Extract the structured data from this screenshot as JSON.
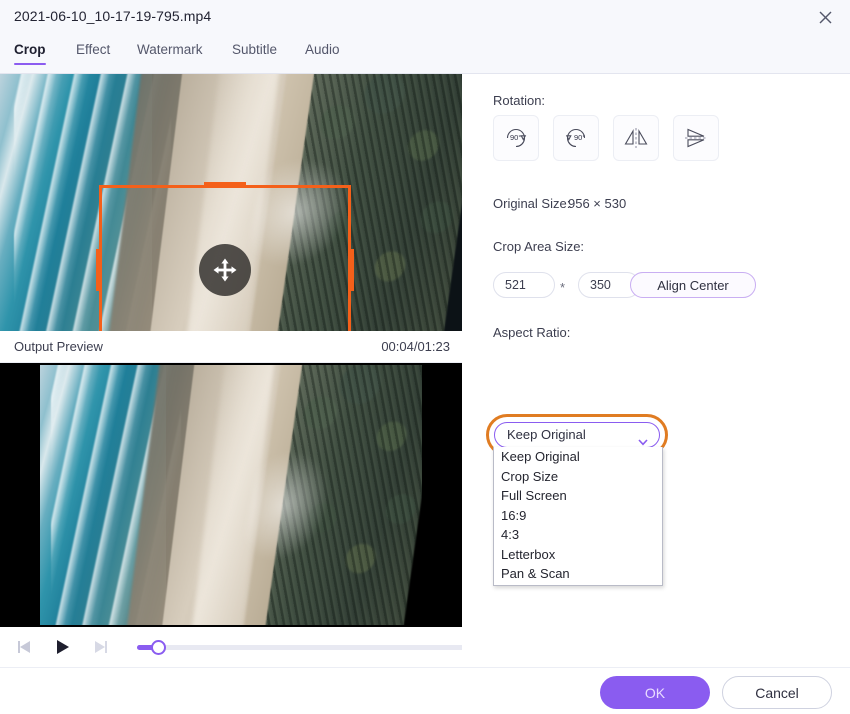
{
  "window": {
    "title": "2021-06-10_10-17-19-795.mp4",
    "close_icon": "close-icon"
  },
  "tabs": [
    {
      "label": "Crop",
      "active": true
    },
    {
      "label": "Effect",
      "active": false
    },
    {
      "label": "Watermark",
      "active": false
    },
    {
      "label": "Subtitle",
      "active": false
    },
    {
      "label": "Audio",
      "active": false
    }
  ],
  "source_preview": {
    "crop_overlay": {
      "move_handle_icon": "move-arrows-icon",
      "border_color": "#f4601a"
    }
  },
  "output_preview": {
    "label": "Output Preview",
    "time": "00:04/01:23"
  },
  "transport": {
    "prev_frame_icon": "previous-frame-icon",
    "play_icon": "play-icon",
    "next_frame_icon": "next-frame-icon",
    "progress_percent": 6
  },
  "panel": {
    "rotation_label": "Rotation:",
    "rotation_buttons": [
      {
        "name": "rotate-right-90",
        "label": "90°"
      },
      {
        "name": "rotate-left-90",
        "label": "90°"
      },
      {
        "name": "flip-horizontal",
        "label": ""
      },
      {
        "name": "flip-vertical",
        "label": ""
      }
    ],
    "original_size_label": "Original Size:",
    "original_size_value": "956 × 530",
    "crop_area_label": "Crop Area Size:",
    "crop_width": "521",
    "crop_height": "350",
    "multiply_symbol": "*",
    "align_center_label": "Align Center",
    "aspect_ratio_label": "Aspect Ratio:",
    "aspect_ratio_selected": "Keep Original",
    "aspect_ratio_options": [
      "Keep Original",
      "Crop Size",
      "Full Screen",
      "16:9",
      "4:3",
      "Letterbox",
      "Pan & Scan"
    ]
  },
  "footer": {
    "ok_label": "OK",
    "cancel_label": "Cancel"
  },
  "colors": {
    "accent_purple": "#8a5cf0",
    "highlight_orange": "#e07c22",
    "crop_orange": "#f4601a"
  }
}
